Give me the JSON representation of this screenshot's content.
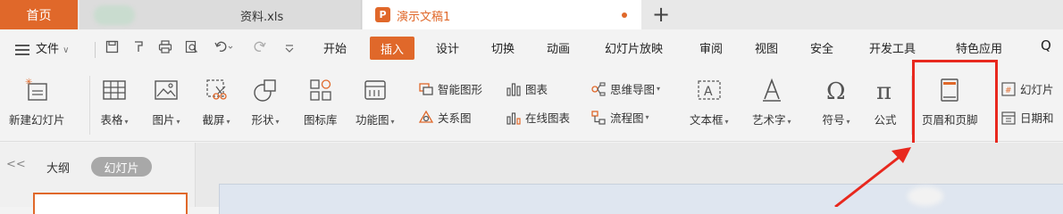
{
  "tabs": {
    "home": "首页",
    "xls": "资料.xls",
    "ppt": "演示文稿1",
    "ppt_icon": "P",
    "add": "+"
  },
  "menu": {
    "file": "文件",
    "items": [
      "开始",
      "插入",
      "设计",
      "切换",
      "动画",
      "幻灯片放映",
      "审阅",
      "视图",
      "安全",
      "开发工具",
      "特色应用"
    ],
    "search_glyph": "Q"
  },
  "ribbon": {
    "new_slide": "新建幻灯片",
    "table": "表格",
    "picture": "图片",
    "screenshot": "截屏",
    "shape": "形状",
    "icon_lib": "图标库",
    "func_chart": "功能图",
    "smart_shape": "智能图形",
    "chart": "图表",
    "relation": "关系图",
    "online_chart": "在线图表",
    "mindmap": "思维导图",
    "flowchart": "流程图",
    "textbox": "文本框",
    "wordart": "艺术字",
    "symbol": "符号",
    "formula": "公式",
    "header_footer": "页眉和页脚",
    "slide_num": "幻灯片",
    "datetime": "日期和"
  },
  "panel": {
    "collapse": "<<",
    "outline": "大纲",
    "slides": "幻灯片"
  },
  "colors": {
    "accent": "#e0682a",
    "highlight": "#e8281e"
  }
}
